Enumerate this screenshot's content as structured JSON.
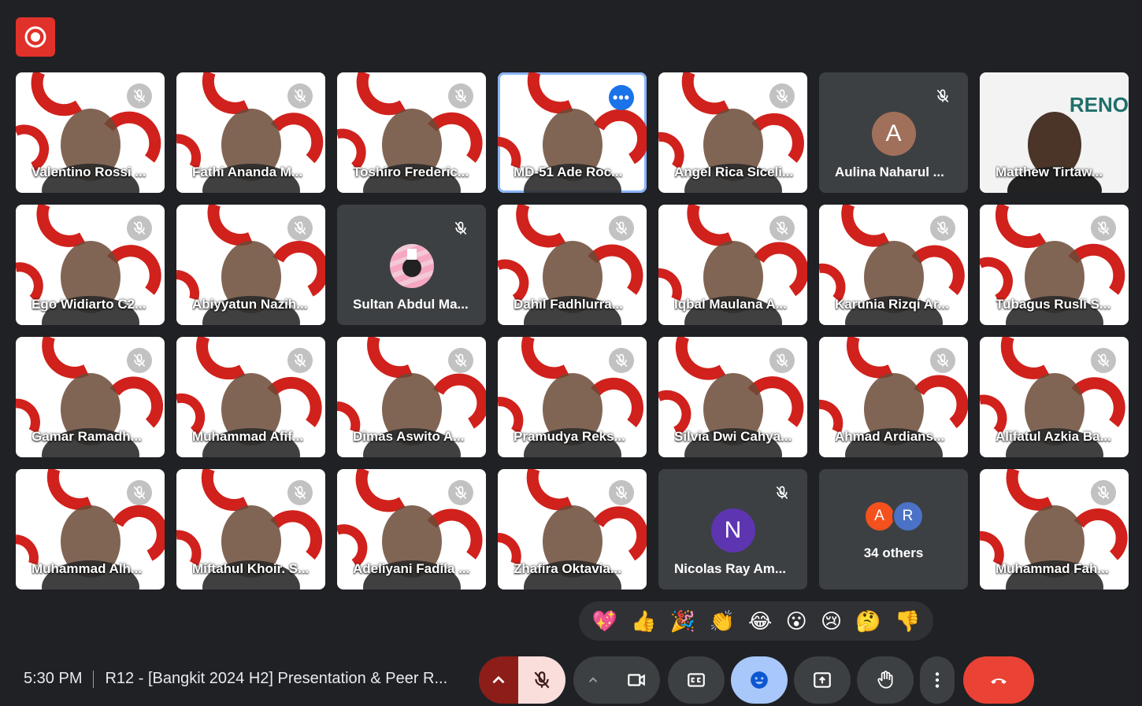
{
  "record_label": "Recording",
  "participants": [
    {
      "name": "Valentino Rossi ...",
      "muted": true
    },
    {
      "name": "Fathi Ananda M...",
      "muted": true
    },
    {
      "name": "Toshiro Frederic...",
      "muted": true
    },
    {
      "name": "MD-51 Ade Roc...",
      "muted": false,
      "active": true
    },
    {
      "name": "Angel Rica Siceli...",
      "muted": true
    },
    {
      "name": "Aulina Naharul ...",
      "muted": true,
      "avatar_letter": "A"
    },
    {
      "name": "Matthew Tirtaw...",
      "muted": false,
      "bg_text": "RENO"
    },
    {
      "name": "Ego Widiarto C2...",
      "muted": true
    },
    {
      "name": "Abiyyatun Nazih...",
      "muted": true
    },
    {
      "name": "Sultan Abdul Ma...",
      "muted": true
    },
    {
      "name": "Dahil Fadhlurra...",
      "muted": true
    },
    {
      "name": "Iqbal Maulana A...",
      "muted": true
    },
    {
      "name": "Karunia Rizqi Ar...",
      "muted": true
    },
    {
      "name": "Tubagus Rusli S...",
      "muted": true
    },
    {
      "name": "Gamar Ramadh...",
      "muted": true
    },
    {
      "name": "Muhammad Afif...",
      "muted": true
    },
    {
      "name": "Dimas Aswito A...",
      "muted": true
    },
    {
      "name": "Pramudya Reks...",
      "muted": true
    },
    {
      "name": "Silvia Dwi Cahya...",
      "muted": true
    },
    {
      "name": "Ahmad Ardians...",
      "muted": true
    },
    {
      "name": "Alifatul Azkia Ba...",
      "muted": true
    },
    {
      "name": "Muhammad Alh...",
      "muted": true
    },
    {
      "name": "Miftahul Khoir. S...",
      "muted": true
    },
    {
      "name": "Adeliyani Fadila ...",
      "muted": true
    },
    {
      "name": "Zhafira Oktavia...",
      "muted": true
    },
    {
      "name": "Nicolas Ray Am...",
      "muted": true,
      "avatar_letter": "N"
    },
    {
      "others": true,
      "mini_letters": [
        "A",
        "R"
      ],
      "label": "34 others"
    },
    {
      "name": "Muhammad Fah...",
      "muted": true
    }
  ],
  "reactions": [
    "💖",
    "👍",
    "🎉",
    "👏",
    "😂",
    "😮",
    "😢",
    "🤔",
    "👎"
  ],
  "bottom_bar": {
    "time": "5:30 PM",
    "meeting_title": "R12 - [Bangkit 2024 H2] Presentation & Peer R..."
  },
  "colors": {
    "background": "#202124",
    "tile_dark": "#3c4043",
    "brand_red": "#e0312a",
    "active_border": "#8ab4f8",
    "hangup": "#ea4335",
    "emoji_btn": "#a8c7fa"
  }
}
